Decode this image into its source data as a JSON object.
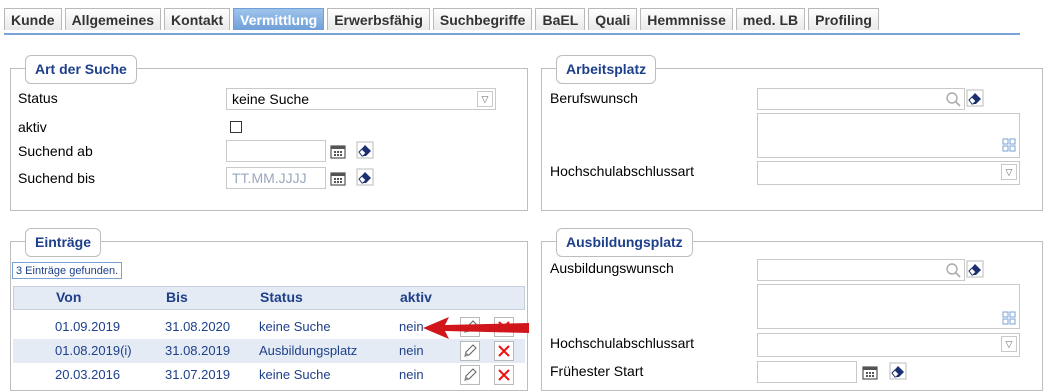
{
  "tabs": [
    "Kunde",
    "Allgemeines",
    "Kontakt",
    "Vermittlung",
    "Erwerbsfähig",
    "Suchbegriffe",
    "BaEL",
    "Quali",
    "Hemmnisse",
    "med. LB",
    "Profiling"
  ],
  "active_tab": "Vermittlung",
  "art_der_suche": {
    "title": "Art der Suche",
    "status_label": "Status",
    "status_value": "keine Suche",
    "aktiv_label": "aktiv",
    "suchend_ab_label": "Suchend ab",
    "suchend_ab_value": "",
    "suchend_bis_label": "Suchend bis",
    "suchend_bis_placeholder": "TT.MM.JJJJ"
  },
  "arbeitsplatz": {
    "title": "Arbeitsplatz",
    "berufswunsch_label": "Berufswunsch",
    "hochschul_label": "Hochschulabschlussart"
  },
  "eintraege": {
    "title": "Einträge",
    "count": "3 Einträge gefunden.",
    "headers": {
      "von": "Von",
      "bis": "Bis",
      "status": "Status",
      "aktiv": "aktiv"
    },
    "rows": [
      {
        "von": "01.09.2019",
        "bis": "31.08.2020",
        "status": "keine Suche",
        "aktiv": "nein"
      },
      {
        "von": "01.08.2019(i)",
        "bis": "31.08.2019",
        "status": "Ausbildungsplatz",
        "aktiv": "nein"
      },
      {
        "von": "20.03.2016",
        "bis": "31.07.2019",
        "status": "keine Suche",
        "aktiv": "nein"
      }
    ]
  },
  "ausbildungsplatz": {
    "title": "Ausbildungsplatz",
    "ausbildungswunsch_label": "Ausbildungswunsch",
    "hochschul_label": "Hochschulabschlussart",
    "fruehester_start_label": "Frühester Start"
  },
  "colors": {
    "accent": "#1e3f8a",
    "tab_active": "#6f9fd8",
    "annotation_arrow": "#d0161b"
  }
}
